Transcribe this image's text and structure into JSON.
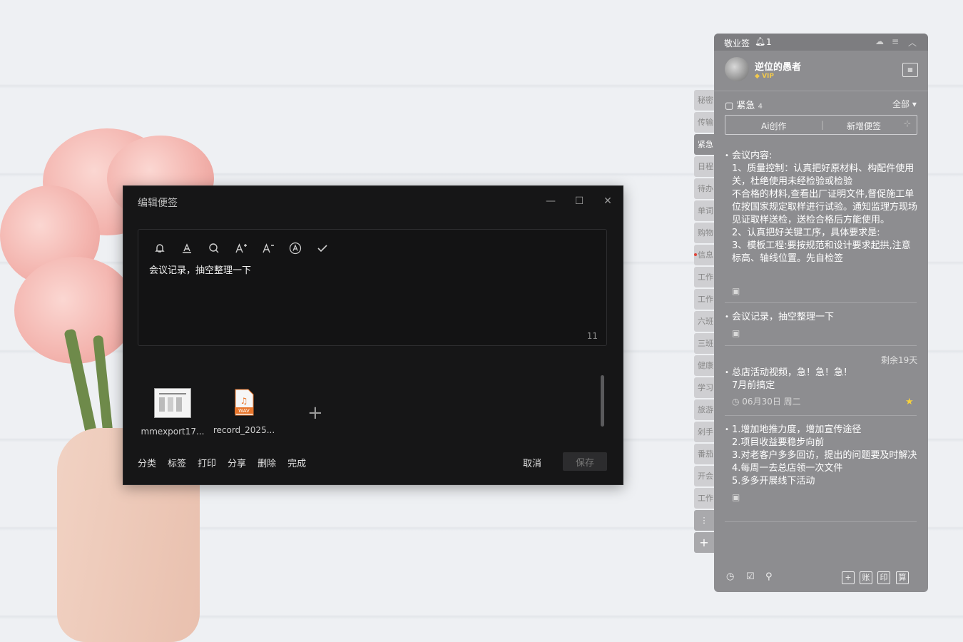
{
  "editor": {
    "title": "编辑便签",
    "content": "会议记录，抽空整理一下",
    "char_count": "11",
    "toolbar_icons": [
      "bell-icon",
      "font-color-icon",
      "search-icon",
      "font-increase-icon",
      "font-decrease-icon",
      "font-style-icon",
      "check-icon"
    ],
    "attachments": [
      {
        "name": "mmexport17...",
        "type": "image"
      },
      {
        "name": "record_2025...",
        "type": "wav",
        "badge": "WAV"
      }
    ],
    "actions": [
      "分类",
      "标签",
      "打印",
      "分享",
      "删除",
      "完成"
    ],
    "cancel": "取消",
    "save": "保存"
  },
  "tabs": [
    {
      "label": "秘密"
    },
    {
      "label": "传输"
    },
    {
      "label": "紧急",
      "active": true
    },
    {
      "label": "日程"
    },
    {
      "label": "待办"
    },
    {
      "label": "单词"
    },
    {
      "label": "购物"
    },
    {
      "label": "信息",
      "dot": true
    },
    {
      "label": "工作"
    },
    {
      "label": "工作"
    },
    {
      "label": "六班"
    },
    {
      "label": "三班"
    },
    {
      "label": "健康"
    },
    {
      "label": "学习"
    },
    {
      "label": "旅游"
    },
    {
      "label": "剁手"
    },
    {
      "label": "番茄"
    },
    {
      "label": "开会"
    },
    {
      "label": "工作"
    }
  ],
  "panel": {
    "app_name": "敬业签",
    "notification_count": "1",
    "user_name": "逆位的愚者",
    "vip": "VIP",
    "category": "紧急",
    "category_count": "4",
    "filter": "全部",
    "ai_button": "Ai创作",
    "new_button": "新增便签",
    "notes": [
      {
        "text": "会议内容:\n1、质量控制：认真把好原材料、构配件使用关，杜绝使用未经检验或检验\n不合格的材料,查看出厂证明文件,督促施工单位按国家规定取样进行试验。通知监理方现场见证取样送检，送检合格后方能使用。\n2、认真把好关键工序，具体要求是:\n3、模板工程:要按规范和设计要求起拱,注意标高、轴线位置。先自检签"
      },
      {
        "text": "会议记录，抽空整理一下"
      },
      {
        "text": "总店活动视频，急！急！急！\n7月前搞定",
        "remaining": "剩余19天",
        "date": "06月30日 周二"
      },
      {
        "text": "1.增加地推力度，增加宣传途径\n2.项目收益要稳步向前\n3.对老客户多多回访，提出的问题要及时解决\n4.每周一去总店领一次文件\n5.多多开展线下活动"
      }
    ],
    "bottom_icons": [
      "clock-icon",
      "check-box-icon",
      "search-icon"
    ],
    "bottom_boxes": [
      "+",
      "账",
      "印",
      "算"
    ]
  }
}
